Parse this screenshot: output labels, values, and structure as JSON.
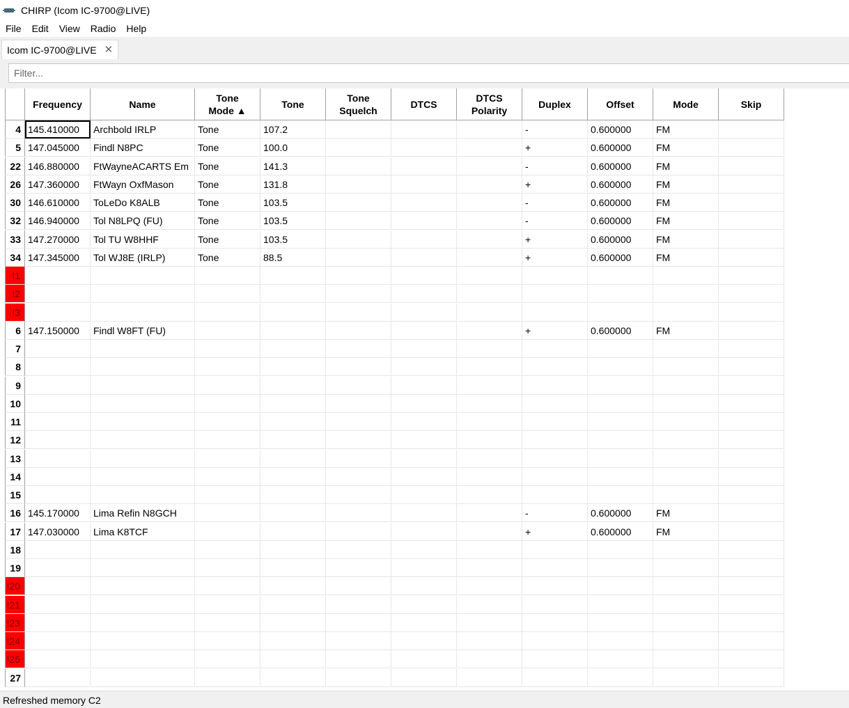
{
  "window": {
    "title": "CHIRP (Icom IC-9700@LIVE)"
  },
  "menu": [
    "File",
    "Edit",
    "View",
    "Radio",
    "Help"
  ],
  "tab": {
    "label": "Icom IC-9700@LIVE",
    "close": "✕"
  },
  "filter": {
    "placeholder": "Filter...",
    "value": ""
  },
  "columns": [
    {
      "key": "freq",
      "label": "Frequency"
    },
    {
      "key": "name",
      "label": "Name"
    },
    {
      "key": "tmode",
      "label": "Tone\nMode ▲"
    },
    {
      "key": "tone",
      "label": "Tone"
    },
    {
      "key": "tsql",
      "label": "Tone\nSquelch"
    },
    {
      "key": "dtcs",
      "label": "DTCS"
    },
    {
      "key": "dtcspol",
      "label": "DTCS\nPolarity"
    },
    {
      "key": "duplex",
      "label": "Duplex"
    },
    {
      "key": "offset",
      "label": "Offset"
    },
    {
      "key": "mode",
      "label": "Mode"
    },
    {
      "key": "skip",
      "label": "Skip"
    }
  ],
  "rows": [
    {
      "num": "4",
      "err": false,
      "cells": [
        "145.410000",
        "Archbold IRLP",
        "Tone",
        "107.2",
        "",
        "",
        "",
        "-",
        "0.600000",
        "FM",
        ""
      ]
    },
    {
      "num": "5",
      "err": false,
      "cells": [
        "147.045000",
        "Findl N8PC",
        "Tone",
        "100.0",
        "",
        "",
        "",
        "+",
        "0.600000",
        "FM",
        ""
      ]
    },
    {
      "num": "22",
      "err": false,
      "cells": [
        "146.880000",
        "FtWayneACARTS Em",
        "Tone",
        "141.3",
        "",
        "",
        "",
        "-",
        "0.600000",
        "FM",
        ""
      ]
    },
    {
      "num": "26",
      "err": false,
      "cells": [
        "147.360000",
        "FtWayn OxfMason",
        "Tone",
        "131.8",
        "",
        "",
        "",
        "+",
        "0.600000",
        "FM",
        ""
      ]
    },
    {
      "num": "30",
      "err": false,
      "cells": [
        "146.610000",
        "ToLeDo K8ALB",
        "Tone",
        "103.5",
        "",
        "",
        "",
        "-",
        "0.600000",
        "FM",
        ""
      ]
    },
    {
      "num": "32",
      "err": false,
      "cells": [
        "146.940000",
        "Tol N8LPQ (FU)",
        "Tone",
        "103.5",
        "",
        "",
        "",
        "-",
        "0.600000",
        "FM",
        ""
      ]
    },
    {
      "num": "33",
      "err": false,
      "cells": [
        "147.270000",
        "Tol TU W8HHF",
        "Tone",
        "103.5",
        "",
        "",
        "",
        "+",
        "0.600000",
        "FM",
        ""
      ]
    },
    {
      "num": "34",
      "err": false,
      "cells": [
        "147.345000",
        "Tol WJ8E (IRLP)",
        "Tone",
        "88.5",
        "",
        "",
        "",
        "+",
        "0.600000",
        "FM",
        ""
      ]
    },
    {
      "num": "!1",
      "err": true,
      "cells": [
        "",
        "",
        "",
        "",
        "",
        "",
        "",
        "",
        "",
        "",
        ""
      ]
    },
    {
      "num": "!2",
      "err": true,
      "cells": [
        "",
        "",
        "",
        "",
        "",
        "",
        "",
        "",
        "",
        "",
        ""
      ]
    },
    {
      "num": "!3",
      "err": true,
      "cells": [
        "",
        "",
        "",
        "",
        "",
        "",
        "",
        "",
        "",
        "",
        ""
      ]
    },
    {
      "num": "6",
      "err": false,
      "cells": [
        "147.150000",
        "Findl W8FT (FU)",
        "",
        "",
        "",
        "",
        "",
        "+",
        "0.600000",
        "FM",
        ""
      ]
    },
    {
      "num": "7",
      "err": false,
      "cells": [
        "",
        "",
        "",
        "",
        "",
        "",
        "",
        "",
        "",
        "",
        ""
      ]
    },
    {
      "num": "8",
      "err": false,
      "cells": [
        "",
        "",
        "",
        "",
        "",
        "",
        "",
        "",
        "",
        "",
        ""
      ]
    },
    {
      "num": "9",
      "err": false,
      "cells": [
        "",
        "",
        "",
        "",
        "",
        "",
        "",
        "",
        "",
        "",
        ""
      ]
    },
    {
      "num": "10",
      "err": false,
      "cells": [
        "",
        "",
        "",
        "",
        "",
        "",
        "",
        "",
        "",
        "",
        ""
      ]
    },
    {
      "num": "11",
      "err": false,
      "cells": [
        "",
        "",
        "",
        "",
        "",
        "",
        "",
        "",
        "",
        "",
        ""
      ]
    },
    {
      "num": "12",
      "err": false,
      "cells": [
        "",
        "",
        "",
        "",
        "",
        "",
        "",
        "",
        "",
        "",
        ""
      ]
    },
    {
      "num": "13",
      "err": false,
      "cells": [
        "",
        "",
        "",
        "",
        "",
        "",
        "",
        "",
        "",
        "",
        ""
      ]
    },
    {
      "num": "14",
      "err": false,
      "cells": [
        "",
        "",
        "",
        "",
        "",
        "",
        "",
        "",
        "",
        "",
        ""
      ]
    },
    {
      "num": "15",
      "err": false,
      "cells": [
        "",
        "",
        "",
        "",
        "",
        "",
        "",
        "",
        "",
        "",
        ""
      ]
    },
    {
      "num": "16",
      "err": false,
      "cells": [
        "145.170000",
        "Lima Refin N8GCH",
        "",
        "",
        "",
        "",
        "",
        "-",
        "0.600000",
        "FM",
        ""
      ]
    },
    {
      "num": "17",
      "err": false,
      "cells": [
        "147.030000",
        "Lima K8TCF",
        "",
        "",
        "",
        "",
        "",
        "+",
        "0.600000",
        "FM",
        ""
      ]
    },
    {
      "num": "18",
      "err": false,
      "cells": [
        "",
        "",
        "",
        "",
        "",
        "",
        "",
        "",
        "",
        "",
        ""
      ]
    },
    {
      "num": "19",
      "err": false,
      "cells": [
        "",
        "",
        "",
        "",
        "",
        "",
        "",
        "",
        "",
        "",
        ""
      ]
    },
    {
      "num": "!20",
      "err": true,
      "cells": [
        "",
        "",
        "",
        "",
        "",
        "",
        "",
        "",
        "",
        "",
        ""
      ]
    },
    {
      "num": "!21",
      "err": true,
      "cells": [
        "",
        "",
        "",
        "",
        "",
        "",
        "",
        "",
        "",
        "",
        ""
      ]
    },
    {
      "num": "!23",
      "err": true,
      "cells": [
        "",
        "",
        "",
        "",
        "",
        "",
        "",
        "",
        "",
        "",
        ""
      ]
    },
    {
      "num": "!24",
      "err": true,
      "cells": [
        "",
        "",
        "",
        "",
        "",
        "",
        "",
        "",
        "",
        "",
        ""
      ]
    },
    {
      "num": "!25",
      "err": true,
      "cells": [
        "",
        "",
        "",
        "",
        "",
        "",
        "",
        "",
        "",
        "",
        ""
      ]
    },
    {
      "num": "27",
      "err": false,
      "cells": [
        "",
        "",
        "",
        "",
        "",
        "",
        "",
        "",
        "",
        "",
        ""
      ]
    }
  ],
  "status": {
    "text": "Refreshed memory C2"
  },
  "colors": {
    "error_row": "#ff0000",
    "grid_line": "#e6e6e6",
    "chrome": "#f0f0f0"
  }
}
